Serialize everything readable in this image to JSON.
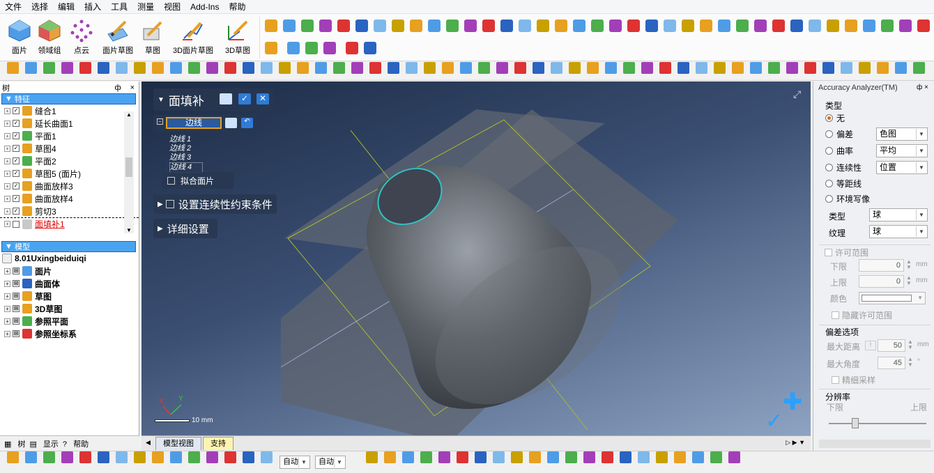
{
  "menu": [
    "文件",
    "选择",
    "编辑",
    "插入",
    "工具",
    "测量",
    "视图",
    "Add-Ins",
    "帮助"
  ],
  "ribbon": {
    "buttons": [
      {
        "label": "面片",
        "icon": "mesh-icon"
      },
      {
        "label": "领域组",
        "icon": "region-group-icon"
      },
      {
        "label": "点云",
        "icon": "point-cloud-icon"
      },
      {
        "label": "面片草图",
        "icon": "mesh-sketch-icon"
      },
      {
        "label": "草图",
        "icon": "sketch-icon"
      },
      {
        "label": "3D面片草图",
        "icon": "3d-mesh-sketch-icon"
      },
      {
        "label": "3D草图",
        "icon": "3d-sketch-icon"
      }
    ]
  },
  "left_panel": {
    "title": "树",
    "pin": "ф",
    "close": "×",
    "features_header": "特征",
    "features": [
      "缝合1",
      "延长曲面1",
      "平面1",
      "草图4",
      "平面2",
      "草图5 (面片)",
      "曲面放样3",
      "曲面放样4",
      "剪切3",
      "面填补1"
    ],
    "model_header": "模型",
    "model_root": "8.01Uxingbeiduiqi",
    "model_items": [
      "面片",
      "曲面体",
      "草图",
      "3D草图",
      "参照平面",
      "参照坐标系"
    ],
    "tabs": [
      "树",
      "显示",
      "帮助"
    ]
  },
  "viewport": {
    "panel_title": "面填补",
    "edges_label": "边线",
    "edges": [
      "边线 1",
      "边线 2",
      "边线 3",
      "边线 4"
    ],
    "fit_patch": "拟合面片",
    "continuity": "设置连续性约束条件",
    "detail": "详细设置",
    "scale": "10 mm",
    "axis_x": "X",
    "axis_y": "Y",
    "tabs": [
      "模型视图",
      "支持"
    ]
  },
  "right_panel": {
    "title": "Accuracy Analyzer(TM)",
    "type_label": "类型",
    "opt_none": "无",
    "opt_dev": "偏差",
    "opt_curv": "曲率",
    "opt_cont": "连续性",
    "opt_iso": "等距线",
    "opt_env": "环境写像",
    "dev_value": "色图",
    "curv_value": "平均",
    "cont_value": "位置",
    "type2_label": "类型",
    "type2_value": "球",
    "texture_label": "纹理",
    "texture_value": "球",
    "tolerance_label": "许可范围",
    "lower": "下限",
    "upper": "上限",
    "lower_val": "0",
    "upper_val": "0",
    "unit": "mm",
    "color_label": "颜色",
    "hide_tol": "隐藏许可范围",
    "dev_options": "偏差选项",
    "max_dist": "最大距离",
    "max_dist_val": "50",
    "max_angle": "最大角度",
    "max_angle_val": "45",
    "deg": "°",
    "fine": "精细采样",
    "resolution": "分辨率",
    "res_low": "下限",
    "res_high": "上限"
  },
  "bottom": {
    "auto1": "自动",
    "auto2": "自动"
  }
}
